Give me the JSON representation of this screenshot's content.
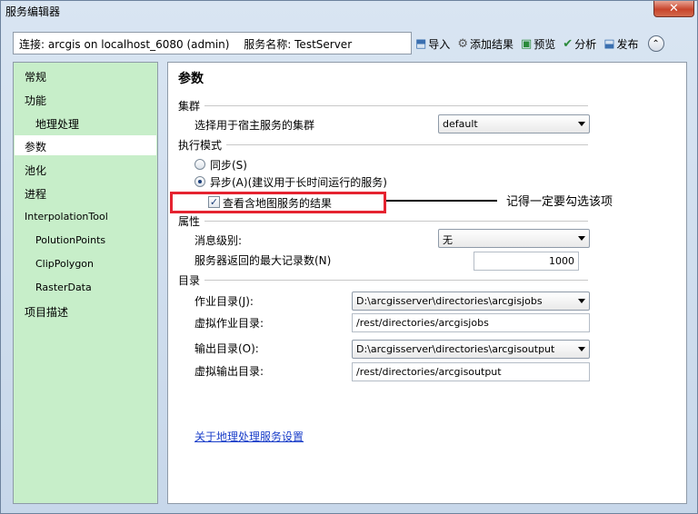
{
  "window": {
    "title": "服务编辑器",
    "close_label": "✕"
  },
  "connection": {
    "label": "连接: arcgis on localhost_6080 (admin)",
    "service_label": "服务名称: TestServer"
  },
  "toolbar": {
    "import": "导入",
    "add_result": "添加结果",
    "preview": "预览",
    "analyze": "分析",
    "publish": "发布",
    "collapse": "⌃"
  },
  "sidebar": {
    "items": [
      {
        "label": "常规"
      },
      {
        "label": "功能"
      },
      {
        "label": "地理处理"
      },
      {
        "label": "参数"
      },
      {
        "label": "池化"
      },
      {
        "label": "进程"
      },
      {
        "label": "InterpolationTool"
      },
      {
        "label": "PolutionPoints"
      },
      {
        "label": "ClipPolygon"
      },
      {
        "label": "RasterData"
      },
      {
        "label": "项目描述"
      }
    ],
    "selected": "参数"
  },
  "main": {
    "title": "参数",
    "cluster": {
      "section": "集群",
      "label": "选择用于宿主服务的集群",
      "value": "default"
    },
    "exec": {
      "section": "执行模式",
      "sync": "同步(S)",
      "async": "异步(A)(建议用于长时间运行的服务)",
      "map_result": "查看含地图服务的结果",
      "map_result_checked": true
    },
    "props": {
      "section": "属性",
      "msg_label": "消息级别:",
      "msg_value": "无",
      "max_label": "服务器返回的最大记录数(N)",
      "max_value": "1000"
    },
    "dirs": {
      "section": "目录",
      "job_label": "作业目录(J):",
      "job_value": "D:\\arcgisserver\\directories\\arcgisjobs",
      "vjob_label": "虚拟作业目录:",
      "vjob_value": "/rest/directories/arcgisjobs",
      "out_label": "输出目录(O):",
      "out_value": "D:\\arcgisserver\\directories\\arcgisoutput",
      "vout_label": "虚拟输出目录:",
      "vout_value": "/rest/directories/arcgisoutput"
    },
    "link": "关于地理处理服务设置"
  },
  "annotation": {
    "text": "记得一定要勾选该项",
    "color": "#e52330"
  },
  "colors": {
    "sidebar_bg": "#c7eec9",
    "link": "#1a3ec9"
  }
}
